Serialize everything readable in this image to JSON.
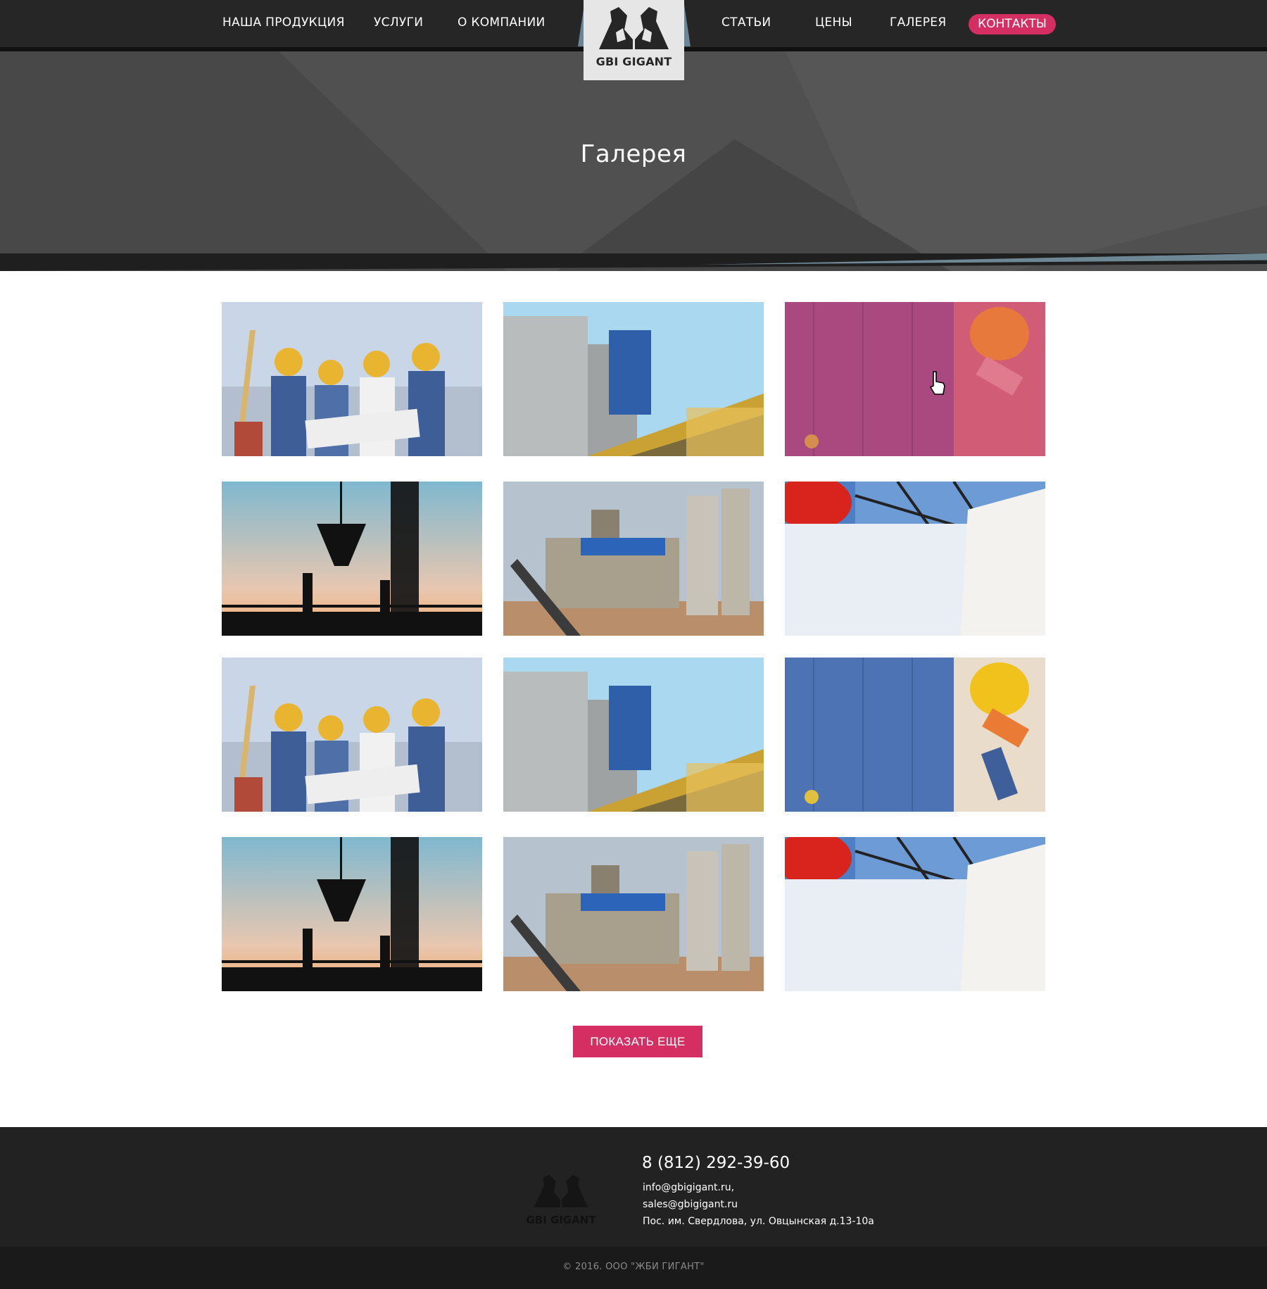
{
  "nav": {
    "items": [
      {
        "label": "НАША ПРОДУКЦИЯ"
      },
      {
        "label": "УСЛУГИ"
      },
      {
        "label": "О КОМПАНИИ"
      },
      {
        "label": "СТАТЬИ"
      },
      {
        "label": "ЦЕНЫ"
      },
      {
        "label": "ГАЛЕРЕЯ"
      }
    ],
    "contacts_label": "КОНТАКТЫ"
  },
  "logo": {
    "text": "GBI GIGANT"
  },
  "hero": {
    "title": "Галерея"
  },
  "gallery": {
    "items": [
      {
        "subject": "workers-in-hardhats"
      },
      {
        "subject": "building-under-construction"
      },
      {
        "subject": "hardhat-on-wood-pink-overlay"
      },
      {
        "subject": "crane-bucket-silhouette"
      },
      {
        "subject": "cement-plant"
      },
      {
        "subject": "engineer-with-blueprint"
      },
      {
        "subject": "workers-in-hardhats"
      },
      {
        "subject": "building-under-construction"
      },
      {
        "subject": "hardhat-on-blue-wood"
      },
      {
        "subject": "crane-bucket-silhouette"
      },
      {
        "subject": "cement-plant"
      },
      {
        "subject": "engineer-with-blueprint"
      }
    ],
    "more_label": "ПОКАЗАТЬ ЕЩЕ"
  },
  "footer": {
    "logo_text": "GBI GIGANT",
    "phone": "8 (812) 292-39-60",
    "email1": "info@gbigigant.ru,",
    "email2": "sales@gbigigant.ru",
    "address": "Пос. им. Свердлова, ул. Овцынская д.13-10а",
    "copyright": "© 2016. ООО \"ЖБИ ГИГАНТ\""
  },
  "colors": {
    "accent": "#d42e62",
    "dark": "#262626",
    "steel_blue": "#6e8795"
  }
}
